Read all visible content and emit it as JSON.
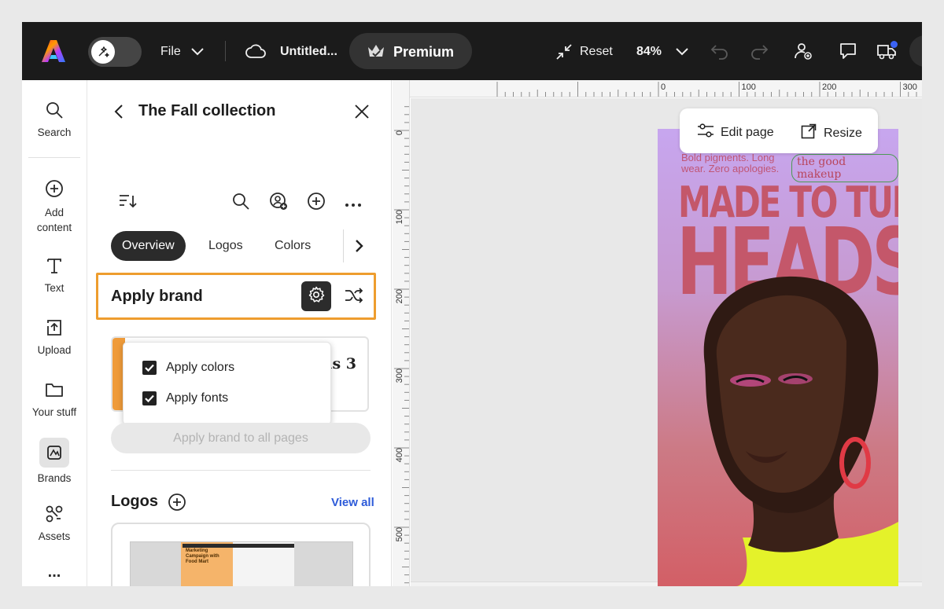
{
  "topbar": {
    "file_label": "File",
    "doc_title": "Untitled...",
    "premium_label": "Premium",
    "reset_label": "Reset",
    "zoom_value": "84%"
  },
  "rail": {
    "items": [
      {
        "label": "Search",
        "icon": "search-icon"
      },
      {
        "label": "Add content",
        "icon": "add-circle-icon"
      },
      {
        "label": "Text",
        "icon": "text-icon"
      },
      {
        "label": "Upload",
        "icon": "upload-icon"
      },
      {
        "label": "Your stuff",
        "icon": "folder-icon"
      },
      {
        "label": "Brands",
        "icon": "brand-icon"
      },
      {
        "label": "Assets",
        "icon": "assets-icon"
      }
    ],
    "more_label": "..."
  },
  "panel": {
    "title": "The Fall collection",
    "tabs": [
      "Overview",
      "Logos",
      "Colors"
    ],
    "apply_brand_title": "Apply brand",
    "brand_card_text": "ns 3",
    "dropdown": {
      "options": [
        {
          "label": "Apply colors",
          "checked": true
        },
        {
          "label": "Apply fonts",
          "checked": true
        }
      ]
    },
    "apply_all_label": "Apply brand to all pages",
    "logos_title": "Logos",
    "view_all_label": "View all",
    "logo_thumb_text": "Marketing Campaign with Food Mart"
  },
  "ruler": {
    "h_labels": [
      "0",
      "100",
      "200",
      "300"
    ],
    "v_labels": [
      "0",
      "100",
      "200",
      "300",
      "400",
      "500"
    ]
  },
  "canvas": {
    "edit_page_label": "Edit page",
    "resize_label": "Resize",
    "poster": {
      "tagline": "Bold pigments. Long wear. Zero apologies.",
      "brand": "the good makeup",
      "headline_1": "MADE TO TURN",
      "headline_2": "HEADS"
    }
  },
  "colors": {
    "highlight": "#ee9d2e",
    "link": "#2d5bd9",
    "topbar": "#1b1b1b"
  }
}
